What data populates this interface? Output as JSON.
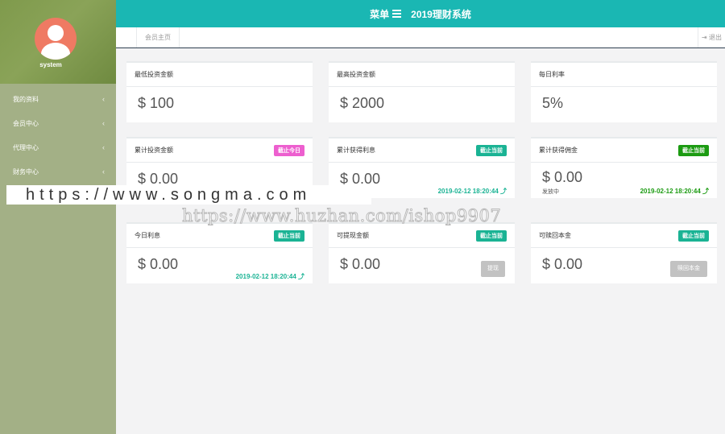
{
  "sidebar": {
    "username": "system",
    "items": [
      {
        "label": "我的资料",
        "chevron": "‹"
      },
      {
        "label": "会员中心",
        "chevron": "‹"
      },
      {
        "label": "代理中心",
        "chevron": "‹"
      },
      {
        "label": "财务中心",
        "chevron": "‹"
      }
    ]
  },
  "topbar": {
    "menu_label": "菜单",
    "title": "2019理财系统"
  },
  "tabs": {
    "home": "会员主页",
    "logout": "⇥ 退出"
  },
  "colors": {
    "accent": "#1ab7b3",
    "pink": "#ed5fcf",
    "teal": "#1ab394",
    "green": "#1c9b12"
  },
  "cards": [
    {
      "title": "最低投资金额",
      "value": "$ 100"
    },
    {
      "title": "最高投资金额",
      "value": "$ 2000"
    },
    {
      "title": "每日利率",
      "value": "5%"
    },
    {
      "title": "累计投资金额",
      "badge": "截止今日",
      "value": "$ 0.00"
    },
    {
      "title": "累计获得利息",
      "badge": "截止当前",
      "value": "$ 0.00",
      "time": "2019-02-12 18:20:44 ⤴"
    },
    {
      "title": "累计获得佣金",
      "badge": "截止当前",
      "value": "$ 0.00",
      "sub": "发放中",
      "time": "2019-02-12 18:20:44 ⤴"
    },
    {
      "title": "今日利息",
      "badge": "截止当前",
      "value": "$ 0.00",
      "time": "2019-02-12 18:20:44 ⤴"
    },
    {
      "title": "可提现金额",
      "badge": "截止当前",
      "value": "$ 0.00",
      "button": "提现"
    },
    {
      "title": "可赎回本金",
      "badge": "截止当前",
      "value": "$ 0.00",
      "button": "赎回本金"
    }
  ],
  "watermarks": {
    "primary": "https://www.songma.com",
    "secondary": "https://www.huzhan.com/ishop9907"
  }
}
